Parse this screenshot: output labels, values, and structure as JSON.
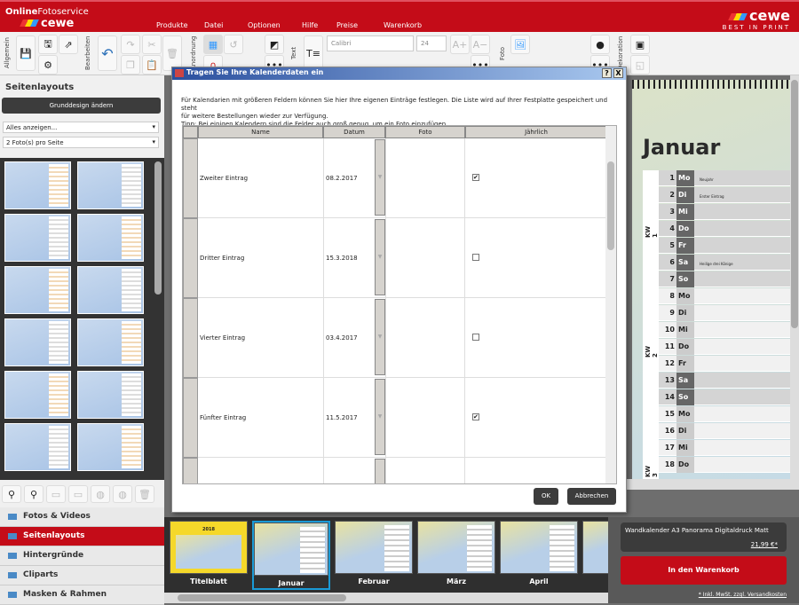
{
  "header": {
    "brand_top_bold": "Online",
    "brand_top": "Fotoservice",
    "brand": "cewe",
    "right_brand": "cewe",
    "right_tagline": "BEST IN PRINT",
    "menu": [
      "Produkte",
      "Datei",
      "Optionen",
      "Hilfe",
      "Preise",
      "Warenkorb"
    ]
  },
  "toolbar": {
    "groups": [
      "Allgemein",
      "Bearbeiten",
      "Anordnung",
      "Text",
      "Foto",
      "Dekoration"
    ],
    "font": "Calibri",
    "size": "24"
  },
  "left": {
    "title": "Seitenlayouts",
    "design_button": "Grunddesign ändern",
    "filter1": "Alles anzeigen...",
    "filter2": "2 Foto(s) pro Seite",
    "nav": [
      {
        "label": "Fotos & Videos",
        "active": false
      },
      {
        "label": "Seitenlayouts",
        "active": true
      },
      {
        "label": "Hintergründe",
        "active": false
      },
      {
        "label": "Cliparts",
        "active": false
      },
      {
        "label": "Masken & Rahmen",
        "active": false
      }
    ]
  },
  "dialog": {
    "title": "Tragen Sie Ihre Kalenderdaten ein",
    "intro1": "Für Kalendarien mit größeren Feldern können Sie hier Ihre eigenen Einträge festlegen. Die Liste wird auf Ihrer Festplatte gespeichert und steht",
    "intro2": "für weitere Bestellungen wieder zur Verfügung.",
    "intro3": "Tipp: Bei einigen Kalendern sind die Felder auch groß genug, um ein Foto einzufügen.",
    "columns": [
      "Name",
      "Datum",
      "Foto",
      "Jährlich"
    ],
    "rows": [
      {
        "name": "Zweiter Eintrag",
        "date": "08.2.2017",
        "yearly": true
      },
      {
        "name": "Dritter Eintrag",
        "date": "15.3.2018",
        "yearly": false
      },
      {
        "name": "Vierter Eintrag",
        "date": "03.4.2017",
        "yearly": false
      },
      {
        "name": "Fünfter Eintrag",
        "date": "11.5.2017",
        "yearly": true
      },
      {
        "name": "",
        "date": "",
        "yearly": false
      }
    ],
    "ok": "OK",
    "cancel": "Abbrechen",
    "help": "?",
    "close": "X"
  },
  "calendar": {
    "month": "Januar",
    "kw": [
      "KW 1",
      "KW 2",
      "KW 3"
    ],
    "days": [
      {
        "n": "1",
        "d": "Mo",
        "e": "Neujahr"
      },
      {
        "n": "2",
        "d": "Di",
        "e": "Erster Eintrag"
      },
      {
        "n": "3",
        "d": "Mi"
      },
      {
        "n": "4",
        "d": "Do"
      },
      {
        "n": "5",
        "d": "Fr"
      },
      {
        "n": "6",
        "d": "Sa",
        "e": "Heilige drei Könige"
      },
      {
        "n": "7",
        "d": "So"
      },
      {
        "n": "8",
        "d": "Mo"
      },
      {
        "n": "9",
        "d": "Di"
      },
      {
        "n": "10",
        "d": "Mi"
      },
      {
        "n": "11",
        "d": "Do"
      },
      {
        "n": "12",
        "d": "Fr"
      },
      {
        "n": "13",
        "d": "Sa"
      },
      {
        "n": "14",
        "d": "So"
      },
      {
        "n": "15",
        "d": "Mo"
      },
      {
        "n": "16",
        "d": "Di"
      },
      {
        "n": "17",
        "d": "Mi"
      },
      {
        "n": "18",
        "d": "Do"
      }
    ]
  },
  "filmstrip": {
    "pages": [
      "Titelblatt",
      "Januar",
      "Februar",
      "März",
      "April"
    ],
    "cover_year": "2018",
    "selected": 1
  },
  "cart": {
    "product": "Wandkalender A3 Panorama Digitaldruck Matt",
    "price": "21,99 €*",
    "button": "In den Warenkorb",
    "shipping": "* Inkl. MwSt. zzgl. Versandkosten"
  }
}
